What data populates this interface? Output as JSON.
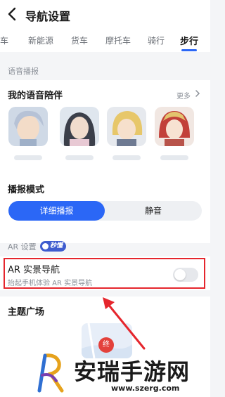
{
  "header": {
    "title": "导航设置"
  },
  "tabs": [
    "客车",
    "新能源",
    "货车",
    "摩托车",
    "骑行",
    "步行"
  ],
  "voice_section": {
    "label": "语音播报",
    "companion_title": "我的语音陪伴",
    "more_label": "更多",
    "broadcast_mode_title": "播报模式",
    "mode_options": [
      "详细播报",
      "静音"
    ],
    "selected_mode": "详细播报"
  },
  "ar_section": {
    "label": "AR 设置",
    "badge": "秒懂",
    "title": "AR 实景导航",
    "subtitle": "抬起手机体验 AR 实景导航",
    "toggle_on": false
  },
  "theme_section": {
    "title": "主题广场",
    "pin_label": "终"
  },
  "watermark": {
    "name": "安瑞手游网",
    "url": "www.szerg.com"
  },
  "colors": {
    "accent": "#2b67f6",
    "highlight": "#e5262d",
    "background": "#f4f5f7"
  }
}
